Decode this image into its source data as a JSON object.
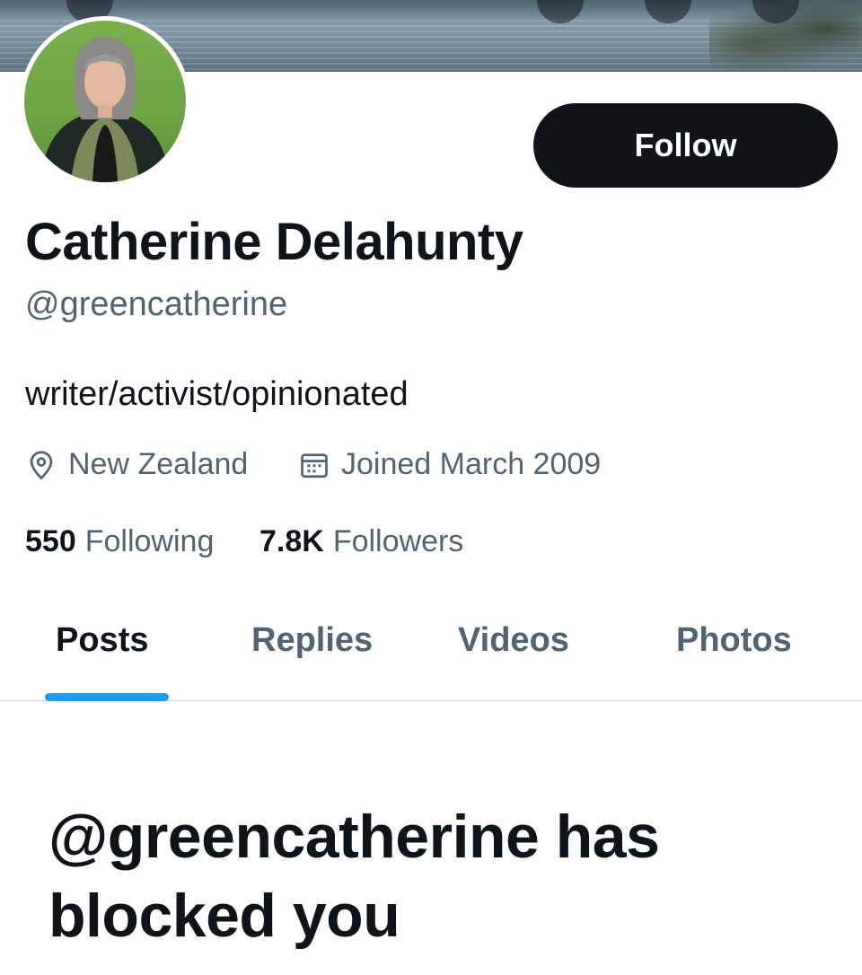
{
  "profile": {
    "display_name": "Catherine Delahunty",
    "handle": "@greencatherine",
    "bio": "writer/activist/opinionated",
    "location": "New Zealand",
    "joined": "Joined March 2009",
    "follow_label": "Follow"
  },
  "stats": {
    "following_count": "550",
    "following_label": "Following",
    "followers_count": "7.8K",
    "followers_label": "Followers"
  },
  "tabs": [
    {
      "label": "Posts",
      "active": true
    },
    {
      "label": "Replies",
      "active": false
    },
    {
      "label": "Videos",
      "active": false
    },
    {
      "label": "Photos",
      "active": false
    }
  ],
  "blocked_message": "@greencatherine has blocked you",
  "colors": {
    "accent": "#1d9bf0",
    "text_primary": "#0f1419",
    "text_secondary": "#536471",
    "button_bg": "#0f1419"
  },
  "icons": {
    "location": "location-pin-icon",
    "joined": "calendar-icon"
  }
}
